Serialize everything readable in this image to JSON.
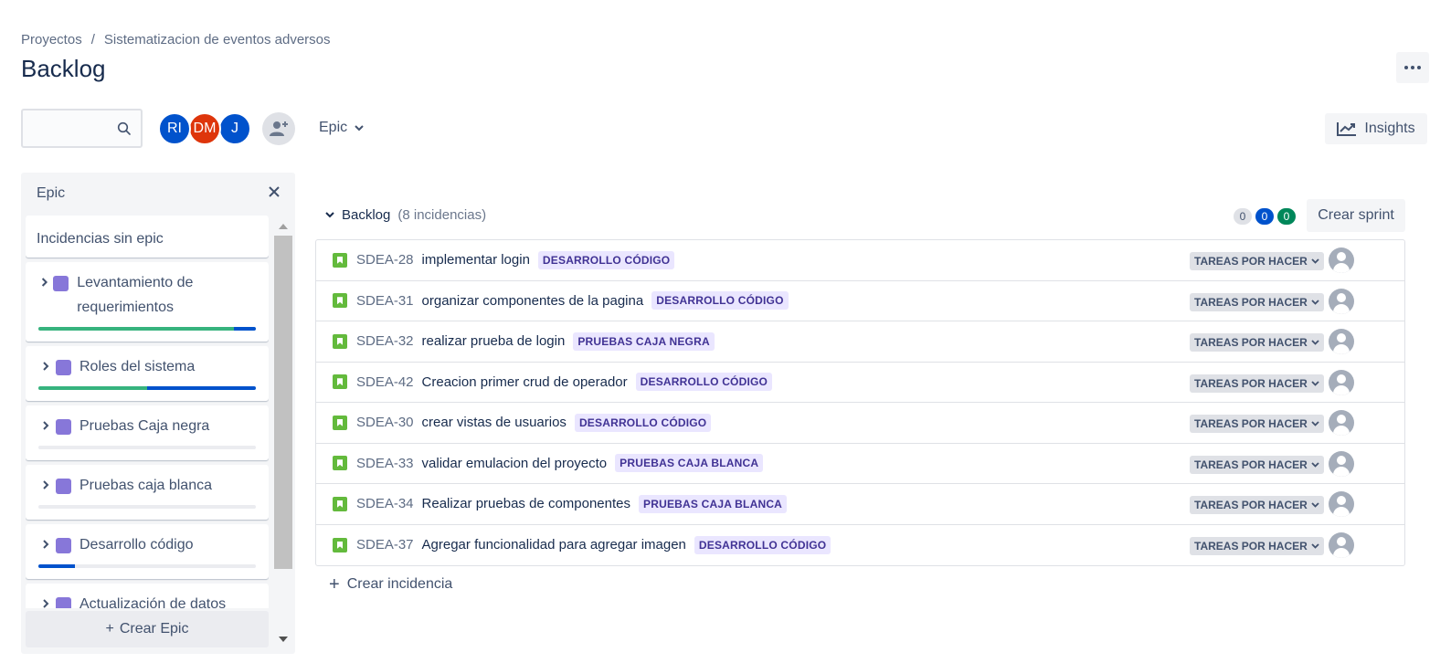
{
  "breadcrumb": {
    "projects": "Proyectos",
    "separator": "/",
    "project": "Sistematizacion de eventos adversos"
  },
  "page_title": "Backlog",
  "search": {
    "placeholder": "",
    "value": ""
  },
  "avatars": [
    {
      "initials": "RI",
      "color": "#0052cc"
    },
    {
      "initials": "DM",
      "color": "#de350b"
    },
    {
      "initials": "J",
      "color": "#0052cc"
    }
  ],
  "epic_filter_label": "Epic",
  "insights_label": "Insights",
  "epic_panel": {
    "title": "Epic",
    "no_epic_label": "Incidencias sin epic",
    "epics": [
      {
        "name": "Levantamiento de requerimientos",
        "done_fraction": 0.9,
        "in_progress_fraction": 0.1
      },
      {
        "name": "Roles del sistema",
        "done_fraction": 0.5,
        "in_progress_fraction": 0.5
      },
      {
        "name": "Pruebas Caja negra",
        "done_fraction": 0,
        "in_progress_fraction": 0
      },
      {
        "name": "Pruebas caja blanca",
        "done_fraction": 0,
        "in_progress_fraction": 0
      },
      {
        "name": "Desarrollo código",
        "done_fraction": 0,
        "in_progress_fraction": 0.17
      },
      {
        "name": "Actualización de datos",
        "done_fraction": 0,
        "in_progress_fraction": 0
      }
    ],
    "create_epic_label": "Crear Epic"
  },
  "backlog": {
    "name": "Backlog",
    "count_label": "(8 incidencias)",
    "badges": [
      {
        "value": "0",
        "bg": "#dfe1e6",
        "fg": "#42526e"
      },
      {
        "value": "0",
        "bg": "#0052cc",
        "fg": "#ffffff"
      },
      {
        "value": "0",
        "bg": "#00875a",
        "fg": "#ffffff"
      }
    ],
    "create_sprint_label": "Crear sprint",
    "issues": [
      {
        "key": "SDEA-28",
        "summary": "implementar login",
        "epic": "DESARROLLO CÓDIGO",
        "status": "TAREAS POR HACER"
      },
      {
        "key": "SDEA-31",
        "summary": "organizar componentes de la pagina",
        "epic": "DESARROLLO CÓDIGO",
        "status": "TAREAS POR HACER"
      },
      {
        "key": "SDEA-32",
        "summary": "realizar prueba de login",
        "epic": "PRUEBAS CAJA NEGRA",
        "status": "TAREAS POR HACER"
      },
      {
        "key": "SDEA-42",
        "summary": "Creacion primer crud de operador",
        "epic": "DESARROLLO CÓDIGO",
        "status": "TAREAS POR HACER"
      },
      {
        "key": "SDEA-30",
        "summary": "crear vistas de usuarios",
        "epic": "DESARROLLO CÓDIGO",
        "status": "TAREAS POR HACER"
      },
      {
        "key": "SDEA-33",
        "summary": "validar emulacion del proyecto",
        "epic": "PRUEBAS CAJA BLANCA",
        "status": "TAREAS POR HACER"
      },
      {
        "key": "SDEA-34",
        "summary": "Realizar pruebas de componentes",
        "epic": "PRUEBAS CAJA BLANCA",
        "status": "TAREAS POR HACER"
      },
      {
        "key": "SDEA-37",
        "summary": "Agregar funcionalidad para agregar imagen",
        "epic": "DESARROLLO CÓDIGO",
        "status": "TAREAS POR HACER"
      }
    ],
    "create_issue_label": "Crear incidencia"
  },
  "icons": {
    "search": "search-icon",
    "more": "more-icon",
    "add_person": "add-person-icon",
    "chevron": "chevron-down-icon",
    "insights": "chart-line-icon",
    "close": "close-icon",
    "story": "story-icon",
    "plus": "plus-icon"
  }
}
